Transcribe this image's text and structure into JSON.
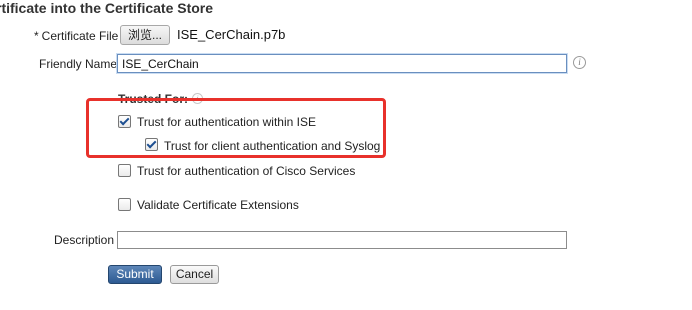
{
  "page": {
    "title": "rtificate into the Certificate Store"
  },
  "form": {
    "certificate_file": {
      "required_marker": "*",
      "label": "Certificate File",
      "browse_label": "浏览...",
      "file_name": "ISE_CerChain.p7b"
    },
    "friendly_name": {
      "label": "Friendly Name",
      "value": "ISE_CerChain"
    },
    "trusted_for": {
      "label": "Trusted For:",
      "options": [
        {
          "label": "Trust for authentication within ISE",
          "checked": true
        },
        {
          "label": "Trust for client authentication and Syslog",
          "checked": true
        },
        {
          "label": "Trust for authentication of Cisco Services",
          "checked": false
        },
        {
          "label": "Validate Certificate Extensions",
          "checked": false
        }
      ]
    },
    "description": {
      "label": "Description",
      "value": ""
    },
    "submit_label": "Submit",
    "cancel_label": "Cancel"
  },
  "icons": {
    "info": "info-icon",
    "checkmark": "checkmark"
  },
  "colors": {
    "highlight": "#e8312b",
    "submit_bg": "#3a6aa5",
    "check": "#1d4f91"
  }
}
